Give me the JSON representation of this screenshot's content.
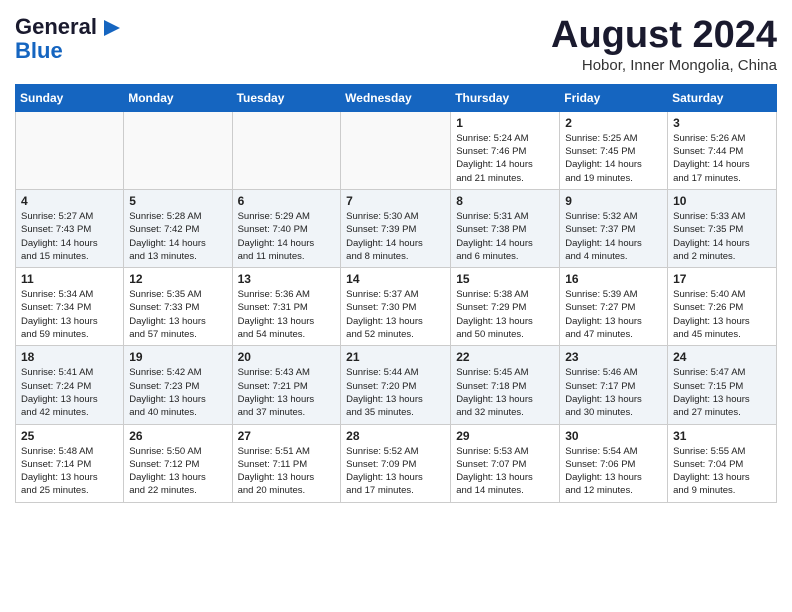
{
  "header": {
    "logo_line1": "General",
    "logo_line2": "Blue",
    "month_year": "August 2024",
    "location": "Hobor, Inner Mongolia, China"
  },
  "weekdays": [
    "Sunday",
    "Monday",
    "Tuesday",
    "Wednesday",
    "Thursday",
    "Friday",
    "Saturday"
  ],
  "weeks": [
    {
      "alt": false,
      "days": [
        {
          "num": "",
          "info": ""
        },
        {
          "num": "",
          "info": ""
        },
        {
          "num": "",
          "info": ""
        },
        {
          "num": "",
          "info": ""
        },
        {
          "num": "1",
          "info": "Sunrise: 5:24 AM\nSunset: 7:46 PM\nDaylight: 14 hours\nand 21 minutes."
        },
        {
          "num": "2",
          "info": "Sunrise: 5:25 AM\nSunset: 7:45 PM\nDaylight: 14 hours\nand 19 minutes."
        },
        {
          "num": "3",
          "info": "Sunrise: 5:26 AM\nSunset: 7:44 PM\nDaylight: 14 hours\nand 17 minutes."
        }
      ]
    },
    {
      "alt": true,
      "days": [
        {
          "num": "4",
          "info": "Sunrise: 5:27 AM\nSunset: 7:43 PM\nDaylight: 14 hours\nand 15 minutes."
        },
        {
          "num": "5",
          "info": "Sunrise: 5:28 AM\nSunset: 7:42 PM\nDaylight: 14 hours\nand 13 minutes."
        },
        {
          "num": "6",
          "info": "Sunrise: 5:29 AM\nSunset: 7:40 PM\nDaylight: 14 hours\nand 11 minutes."
        },
        {
          "num": "7",
          "info": "Sunrise: 5:30 AM\nSunset: 7:39 PM\nDaylight: 14 hours\nand 8 minutes."
        },
        {
          "num": "8",
          "info": "Sunrise: 5:31 AM\nSunset: 7:38 PM\nDaylight: 14 hours\nand 6 minutes."
        },
        {
          "num": "9",
          "info": "Sunrise: 5:32 AM\nSunset: 7:37 PM\nDaylight: 14 hours\nand 4 minutes."
        },
        {
          "num": "10",
          "info": "Sunrise: 5:33 AM\nSunset: 7:35 PM\nDaylight: 14 hours\nand 2 minutes."
        }
      ]
    },
    {
      "alt": false,
      "days": [
        {
          "num": "11",
          "info": "Sunrise: 5:34 AM\nSunset: 7:34 PM\nDaylight: 13 hours\nand 59 minutes."
        },
        {
          "num": "12",
          "info": "Sunrise: 5:35 AM\nSunset: 7:33 PM\nDaylight: 13 hours\nand 57 minutes."
        },
        {
          "num": "13",
          "info": "Sunrise: 5:36 AM\nSunset: 7:31 PM\nDaylight: 13 hours\nand 54 minutes."
        },
        {
          "num": "14",
          "info": "Sunrise: 5:37 AM\nSunset: 7:30 PM\nDaylight: 13 hours\nand 52 minutes."
        },
        {
          "num": "15",
          "info": "Sunrise: 5:38 AM\nSunset: 7:29 PM\nDaylight: 13 hours\nand 50 minutes."
        },
        {
          "num": "16",
          "info": "Sunrise: 5:39 AM\nSunset: 7:27 PM\nDaylight: 13 hours\nand 47 minutes."
        },
        {
          "num": "17",
          "info": "Sunrise: 5:40 AM\nSunset: 7:26 PM\nDaylight: 13 hours\nand 45 minutes."
        }
      ]
    },
    {
      "alt": true,
      "days": [
        {
          "num": "18",
          "info": "Sunrise: 5:41 AM\nSunset: 7:24 PM\nDaylight: 13 hours\nand 42 minutes."
        },
        {
          "num": "19",
          "info": "Sunrise: 5:42 AM\nSunset: 7:23 PM\nDaylight: 13 hours\nand 40 minutes."
        },
        {
          "num": "20",
          "info": "Sunrise: 5:43 AM\nSunset: 7:21 PM\nDaylight: 13 hours\nand 37 minutes."
        },
        {
          "num": "21",
          "info": "Sunrise: 5:44 AM\nSunset: 7:20 PM\nDaylight: 13 hours\nand 35 minutes."
        },
        {
          "num": "22",
          "info": "Sunrise: 5:45 AM\nSunset: 7:18 PM\nDaylight: 13 hours\nand 32 minutes."
        },
        {
          "num": "23",
          "info": "Sunrise: 5:46 AM\nSunset: 7:17 PM\nDaylight: 13 hours\nand 30 minutes."
        },
        {
          "num": "24",
          "info": "Sunrise: 5:47 AM\nSunset: 7:15 PM\nDaylight: 13 hours\nand 27 minutes."
        }
      ]
    },
    {
      "alt": false,
      "days": [
        {
          "num": "25",
          "info": "Sunrise: 5:48 AM\nSunset: 7:14 PM\nDaylight: 13 hours\nand 25 minutes."
        },
        {
          "num": "26",
          "info": "Sunrise: 5:50 AM\nSunset: 7:12 PM\nDaylight: 13 hours\nand 22 minutes."
        },
        {
          "num": "27",
          "info": "Sunrise: 5:51 AM\nSunset: 7:11 PM\nDaylight: 13 hours\nand 20 minutes."
        },
        {
          "num": "28",
          "info": "Sunrise: 5:52 AM\nSunset: 7:09 PM\nDaylight: 13 hours\nand 17 minutes."
        },
        {
          "num": "29",
          "info": "Sunrise: 5:53 AM\nSunset: 7:07 PM\nDaylight: 13 hours\nand 14 minutes."
        },
        {
          "num": "30",
          "info": "Sunrise: 5:54 AM\nSunset: 7:06 PM\nDaylight: 13 hours\nand 12 minutes."
        },
        {
          "num": "31",
          "info": "Sunrise: 5:55 AM\nSunset: 7:04 PM\nDaylight: 13 hours\nand 9 minutes."
        }
      ]
    }
  ]
}
